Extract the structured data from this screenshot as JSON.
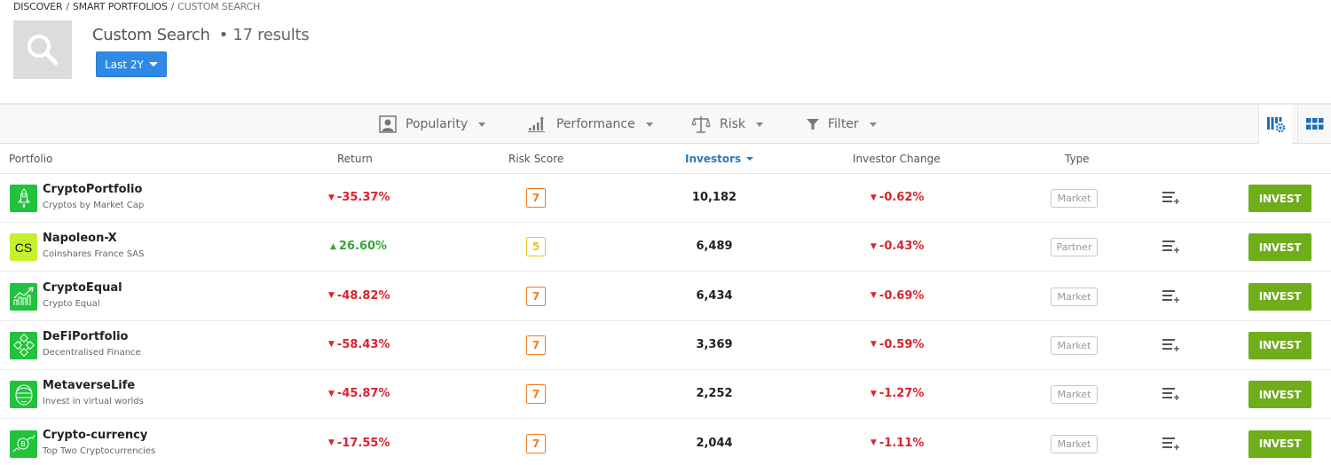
{
  "breadcrumb": [
    "DISCOVER",
    "SMART PORTFOLIOS",
    "CUSTOM SEARCH"
  ],
  "header": {
    "title": "Custom Search",
    "results": "• 17 results",
    "period_button": "Last 2Y"
  },
  "toolbar": {
    "items": [
      {
        "label": "Popularity",
        "icon": "user-icon"
      },
      {
        "label": "Performance",
        "icon": "bar-chart-icon"
      },
      {
        "label": "Risk",
        "icon": "scale-icon"
      },
      {
        "label": "Filter",
        "icon": "filter-icon"
      }
    ],
    "view_buttons": [
      "columns-settings-icon",
      "grid-view-icon"
    ]
  },
  "colors": {
    "negative": "#d9232e",
    "positive": "#3aa535",
    "invest": "#6fad1a",
    "accent": "#2e8ae6",
    "risk7": "#f07d22",
    "risk5": "#e8c623"
  },
  "table": {
    "columns": [
      "Portfolio",
      "Return",
      "Risk Score",
      "Investors",
      "Investor Change",
      "Type"
    ],
    "sorted_column": "Investors",
    "invest_label": "INVEST",
    "rows": [
      {
        "name": "CryptoPortfolio",
        "subtitle": "Cryptos by Market Cap",
        "icon": "rocket-icon",
        "return": "-35.37%",
        "return_dir": "down",
        "risk": "7",
        "investors": "10,182",
        "change": "-0.62%",
        "type": "Market"
      },
      {
        "name": "Napoleon-X",
        "subtitle": "Coinshares France SAS",
        "icon": "cs-logo",
        "icon_text": "CS",
        "return": "26.60%",
        "return_dir": "up",
        "risk": "5",
        "investors": "6,489",
        "change": "-0.43%",
        "type": "Partner"
      },
      {
        "name": "CryptoEqual",
        "subtitle": "Crypto Equal",
        "icon": "growth-chart-icon",
        "return": "-48.82%",
        "return_dir": "down",
        "risk": "7",
        "investors": "6,434",
        "change": "-0.69%",
        "type": "Market"
      },
      {
        "name": "DeFiPortfolio",
        "subtitle": "Decentralised Finance",
        "icon": "network-cubes-icon",
        "return": "-58.43%",
        "return_dir": "down",
        "risk": "7",
        "investors": "3,369",
        "change": "-0.59%",
        "type": "Market"
      },
      {
        "name": "MetaverseLife",
        "subtitle": "Invest in virtual worlds",
        "icon": "vr-headset-icon",
        "return": "-45.87%",
        "return_dir": "down",
        "risk": "7",
        "investors": "2,252",
        "change": "-1.27%",
        "type": "Market"
      },
      {
        "name": "Crypto-currency",
        "subtitle": "Top Two Cryptocurrencies",
        "icon": "bitcoin-chart-icon",
        "return": "-17.55%",
        "return_dir": "down",
        "risk": "7",
        "investors": "2,044",
        "change": "-1.11%",
        "type": "Market"
      }
    ]
  }
}
